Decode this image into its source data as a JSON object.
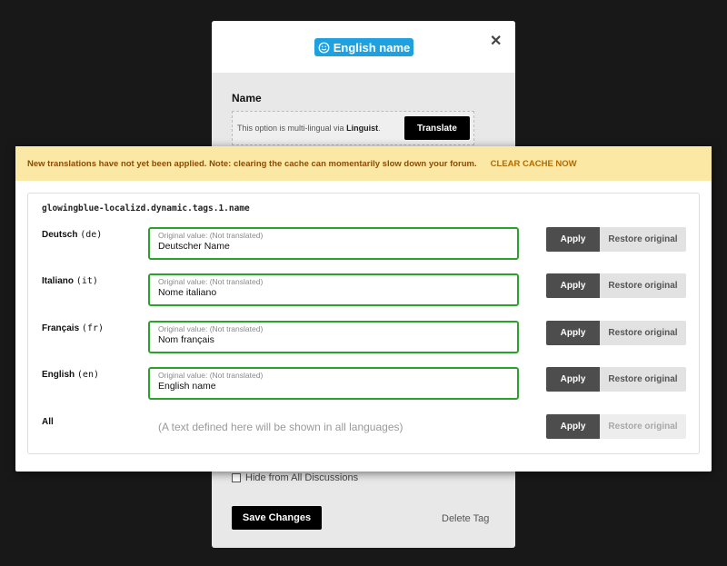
{
  "tag": {
    "name": "English name"
  },
  "edit_modal": {
    "name_label": "Name",
    "linguist_note_prefix": "This option is multi-lingual via",
    "linguist_note_brand": "Linguist",
    "linguist_note_suffix": ".",
    "translate_button": "Translate",
    "hide_checkbox_label": "Hide from All Discussions",
    "save_button": "Save Changes",
    "delete_link": "Delete Tag",
    "close_symbol": "✕"
  },
  "notice": {
    "text": "New translations have not yet been applied. Note: clearing the cache can momentarily slow down your forum.",
    "action": "CLEAR CACHE NOW"
  },
  "translation_key": "glowingblue-localizd.dynamic.tags.1.name",
  "languages": [
    {
      "name": "Deutsch",
      "code": "(de)",
      "hint": "Original value: (Not translated)",
      "value": "Deutscher Name",
      "apply": "Apply",
      "restore": "Restore original"
    },
    {
      "name": "Italiano",
      "code": "(it)",
      "hint": "Original value: (Not translated)",
      "value": "Nome italiano",
      "apply": "Apply",
      "restore": "Restore original"
    },
    {
      "name": "Français",
      "code": "(fr)",
      "hint": "Original value: (Not translated)",
      "value": "Nom français",
      "apply": "Apply",
      "restore": "Restore original"
    },
    {
      "name": "English",
      "code": "(en)",
      "hint": "Original value: (Not translated)",
      "value": "English name",
      "apply": "Apply",
      "restore": "Restore original"
    }
  ],
  "all_row": {
    "label": "All",
    "placeholder": "(A text defined here will be shown in all languages)",
    "apply": "Apply",
    "restore": "Restore original"
  },
  "colors": {
    "tag_blue": "#1fa1e0",
    "notice_bg": "#fbe8a4",
    "field_border_green": "#29a329",
    "apply_bg": "#4d4d4d"
  }
}
